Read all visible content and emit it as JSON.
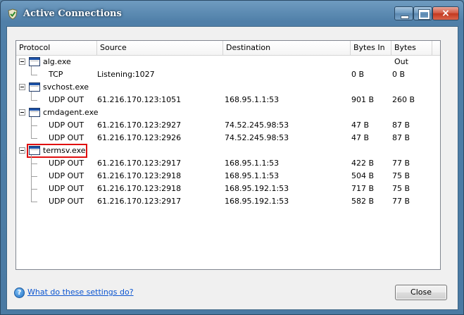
{
  "window": {
    "title": "Active Connections",
    "controls": {
      "minimize": "minimize",
      "maximize": "maximize",
      "close": "×"
    }
  },
  "table": {
    "columns": [
      "Protocol",
      "Source",
      "Destination",
      "Bytes In",
      "Bytes Out"
    ],
    "groups": [
      {
        "process": "alg.exe",
        "highlighted": false,
        "connections": [
          {
            "protocol": "TCP",
            "source": "Listening:1027",
            "destination": "",
            "bytes_in": "0 B",
            "bytes_out": "0 B"
          }
        ]
      },
      {
        "process": "svchost.exe",
        "highlighted": false,
        "connections": [
          {
            "protocol": "UDP OUT",
            "source": "61.216.170.123:1051",
            "destination": "168.95.1.1:53",
            "bytes_in": "901 B",
            "bytes_out": "260 B"
          }
        ]
      },
      {
        "process": "cmdagent.exe",
        "highlighted": false,
        "connections": [
          {
            "protocol": "UDP OUT",
            "source": "61.216.170.123:2927",
            "destination": "74.52.245.98:53",
            "bytes_in": "47 B",
            "bytes_out": "87 B"
          },
          {
            "protocol": "UDP OUT",
            "source": "61.216.170.123:2926",
            "destination": "74.52.245.98:53",
            "bytes_in": "47 B",
            "bytes_out": "87 B"
          }
        ]
      },
      {
        "process": "termsv.exe",
        "highlighted": true,
        "connections": [
          {
            "protocol": "UDP OUT",
            "source": "61.216.170.123:2917",
            "destination": "168.95.1.1:53",
            "bytes_in": "422 B",
            "bytes_out": "77 B"
          },
          {
            "protocol": "UDP OUT",
            "source": "61.216.170.123:2918",
            "destination": "168.95.1.1:53",
            "bytes_in": "504 B",
            "bytes_out": "75 B"
          },
          {
            "protocol": "UDP OUT",
            "source": "61.216.170.123:2918",
            "destination": "168.95.192.1:53",
            "bytes_in": "717 B",
            "bytes_out": "75 B"
          },
          {
            "protocol": "UDP OUT",
            "source": "61.216.170.123:2917",
            "destination": "168.95.192.1:53",
            "bytes_in": "582 B",
            "bytes_out": "77 B"
          }
        ]
      }
    ]
  },
  "footer": {
    "help_icon": "?",
    "help_link": "What do these settings do?",
    "close_button": "Close"
  },
  "colors": {
    "highlight": "#e01010",
    "link": "#0b55d0"
  }
}
